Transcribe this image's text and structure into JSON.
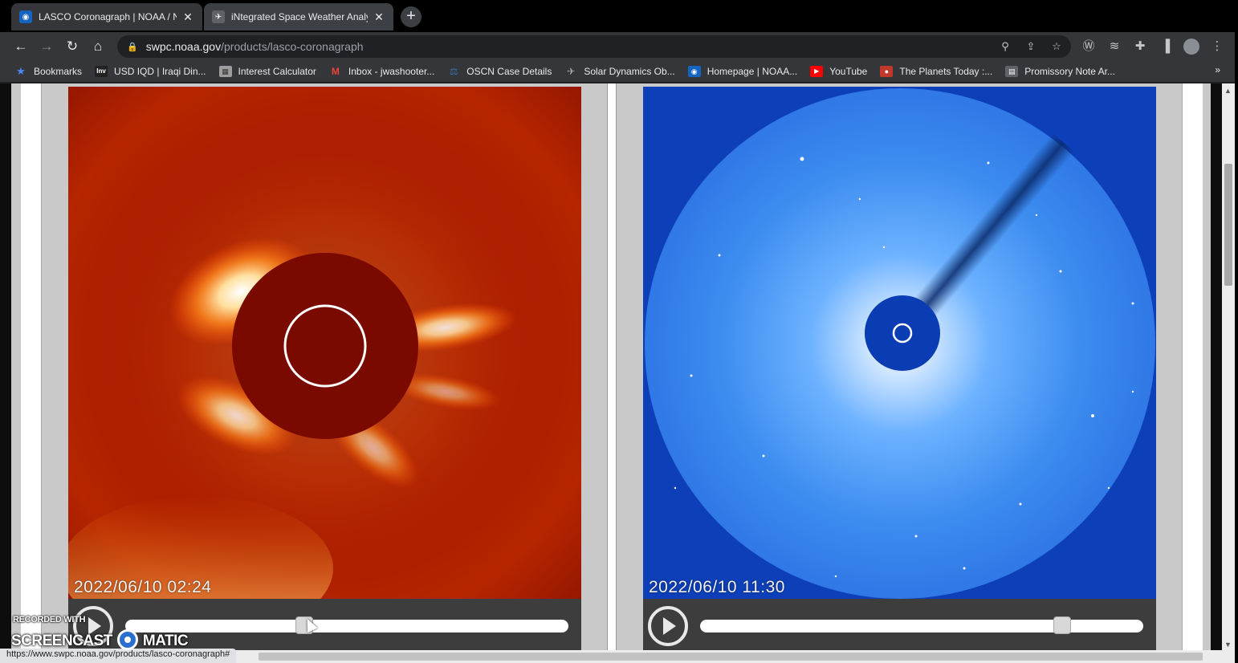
{
  "browser": {
    "tabs": [
      {
        "title": "LASCO Coronagraph | NOAA / NWS Space Weather Prediction Center",
        "active": true
      },
      {
        "title": "iNtegrated Space Weather Analysis",
        "active": false
      }
    ],
    "new_tab_label": "+"
  },
  "toolbar": {
    "url_host": "swpc.noaa.gov",
    "url_path": "/products/lasco-coronagraph"
  },
  "bookmarks": {
    "items": [
      {
        "label": "Bookmarks",
        "icon": "star-icon",
        "color": "#4c8bf5"
      },
      {
        "label": "USD IQD | Iraqi Din...",
        "icon": "inv-icon",
        "color": "#222222"
      },
      {
        "label": "Interest Calculator",
        "icon": "calculator-icon",
        "color": "#9e9e9e"
      },
      {
        "label": "Inbox - jwashooter...",
        "icon": "gmail-icon",
        "color": "#ea4335"
      },
      {
        "label": "OSCN Case Details",
        "icon": "oscn-icon",
        "color": "#3b6fb6"
      },
      {
        "label": "Solar Dynamics Ob...",
        "icon": "satellite-icon",
        "color": "#777777"
      },
      {
        "label": "Homepage | NOAA...",
        "icon": "noaa-icon",
        "color": "#1565c0"
      },
      {
        "label": "YouTube",
        "icon": "youtube-icon",
        "color": "#ff0000"
      },
      {
        "label": "The Planets Today :...",
        "icon": "planets-icon",
        "color": "#c0392b"
      },
      {
        "label": "Promissory Note Ar...",
        "icon": "document-icon",
        "color": "#5f6368"
      }
    ],
    "more_label": "»"
  },
  "viewers": [
    {
      "name": "lasco-c2",
      "timestamp": "2022/06/10 02:24",
      "slider_position": 0.4,
      "theme_color": "#a01a00"
    },
    {
      "name": "lasco-c3",
      "timestamp": "2022/06/10 11:30",
      "slider_position": 0.83,
      "theme_color": "#1a55d8"
    }
  ],
  "status_url": "https://www.swpc.noaa.gov/products/lasco-coronagraph#",
  "watermark": {
    "top_text": "RECORDED WITH",
    "left_word": "SCREENCAST",
    "right_word": "MATIC"
  }
}
